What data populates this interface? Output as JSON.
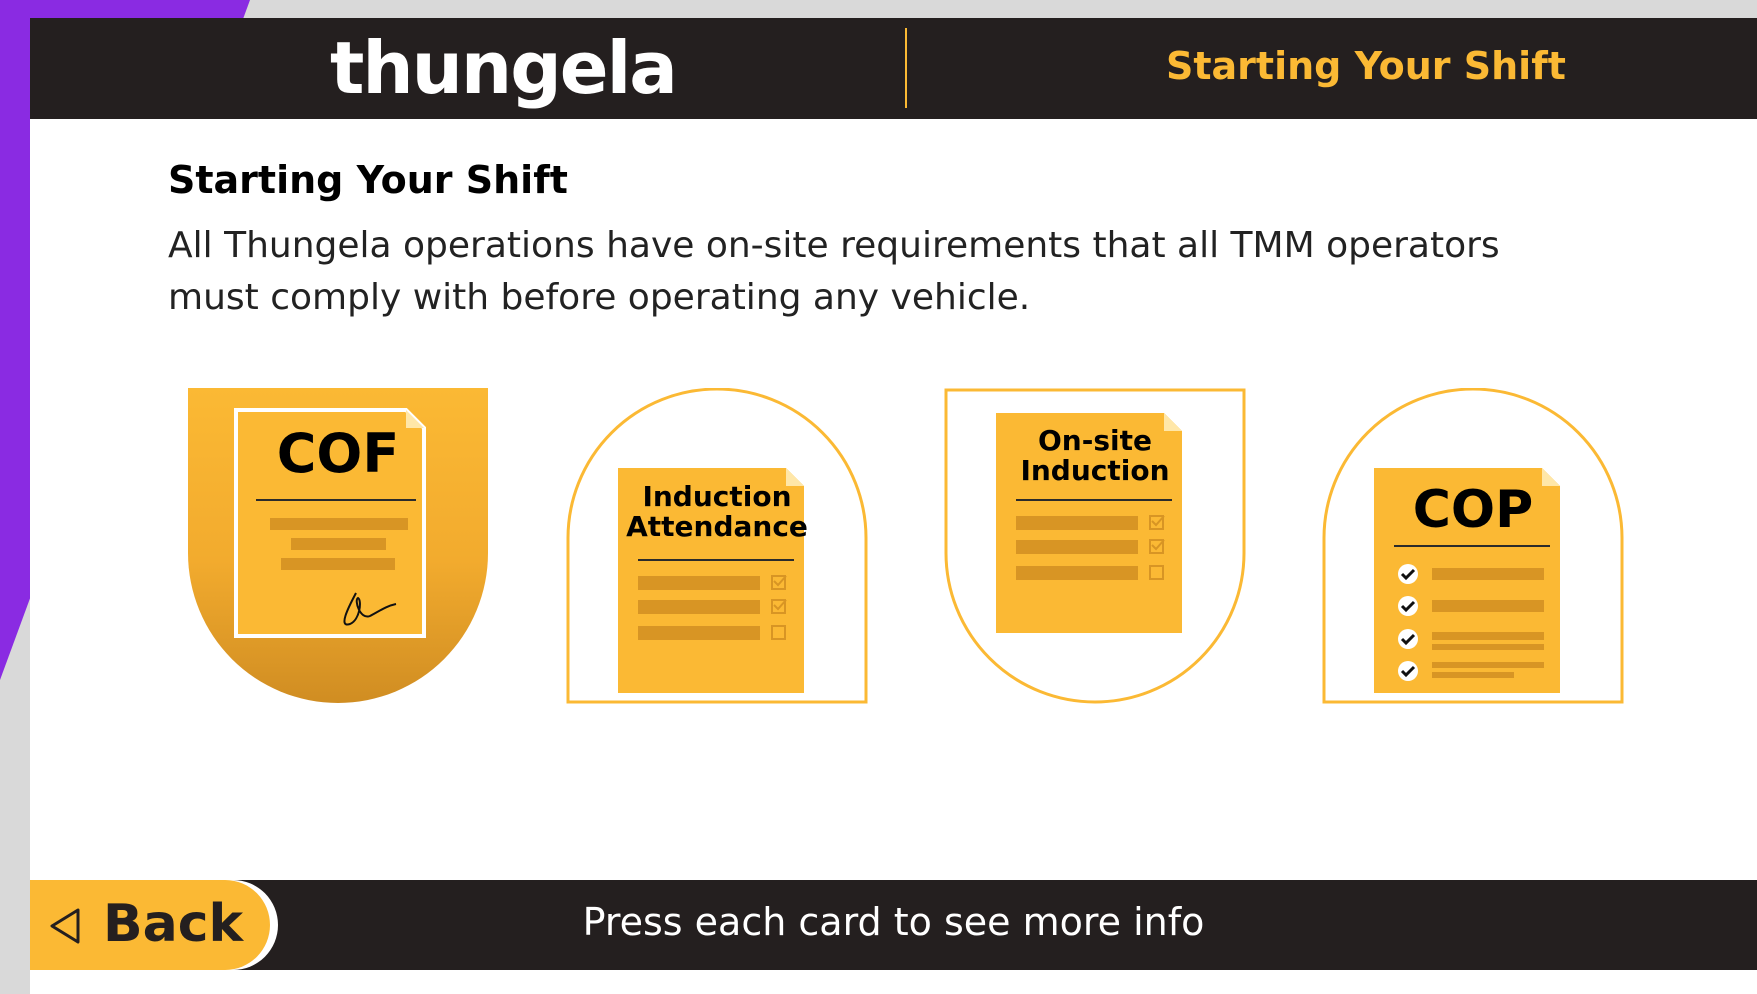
{
  "header": {
    "logo_text": "thungela",
    "title": "Starting Your Shift"
  },
  "content": {
    "heading": "Starting Your Shift",
    "description": "All Thungela operations have on-site requirements that all TMM operators must comply with before operating any vehicle."
  },
  "cards": [
    {
      "label_line1": "COF",
      "label_line2": ""
    },
    {
      "label_line1": "Induction",
      "label_line2": "Attendance"
    },
    {
      "label_line1": "On-site",
      "label_line2": "Induction"
    },
    {
      "label_line1": "COP",
      "label_line2": ""
    }
  ],
  "footer": {
    "back_label": "Back",
    "hint": "Press each card to see more info"
  },
  "colors": {
    "accent": "#fbb934",
    "dark": "#241f1f",
    "purple": "#8a2be2",
    "gold_dark": "#d89524"
  },
  "icons": [
    "back-arrow-icon",
    "signature-icon",
    "checkbox-icon",
    "checkmark-icon"
  ]
}
